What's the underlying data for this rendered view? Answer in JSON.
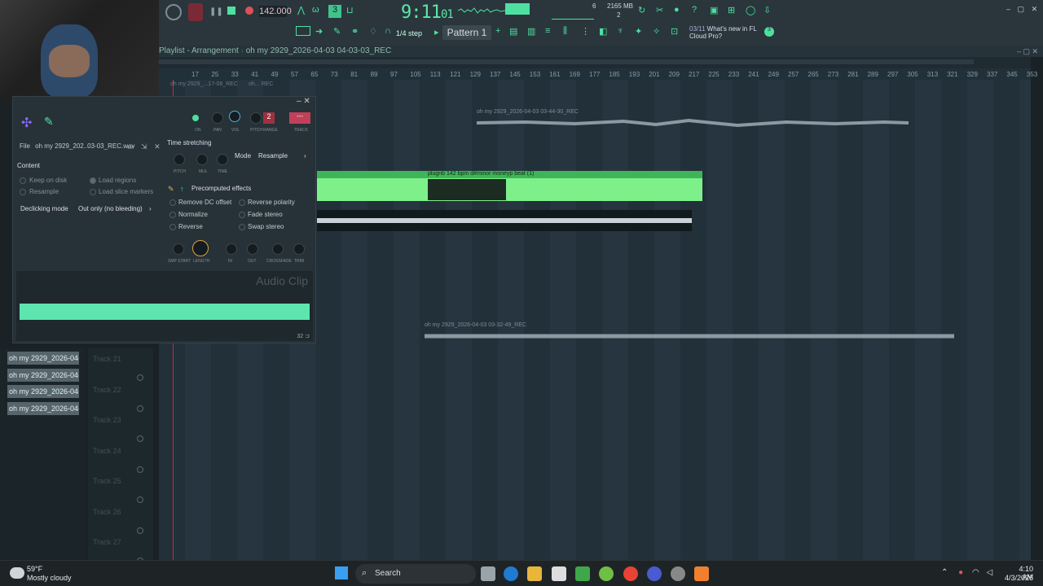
{
  "toolbar": {
    "tempo": "142.000",
    "time": "9:11",
    "time_sub": "01",
    "memory": "2165 MB",
    "cpu_top": "6",
    "cpu_bottom": "2",
    "step": "1/4 step",
    "pattern": "Pattern 1",
    "news_date": "03/11",
    "news_text": "What's new in FL",
    "news_text2": "Cloud Pro?",
    "news_count": "3"
  },
  "playlist": {
    "breadcrumb": "Playlist - Arrangement",
    "file": "oh my 2929_2026-04-03 04-03-03_REC",
    "ruler": [
      "17",
      "25",
      "33",
      "41",
      "49",
      "57",
      "65",
      "73",
      "81",
      "89",
      "97",
      "105",
      "113",
      "121",
      "129",
      "137",
      "145",
      "153",
      "161",
      "169",
      "177",
      "185",
      "193",
      "201",
      "209",
      "217",
      "225",
      "233",
      "241",
      "249",
      "257",
      "265",
      "273",
      "281",
      "289",
      "297",
      "305",
      "313",
      "321",
      "329",
      "337",
      "345",
      "353"
    ],
    "mini_clip1": "oh my 2929_...17-08_REC",
    "mini_clip2": "oh... REC",
    "clip_top": "oh my 2929_2026-04-03 03-44-30_REC",
    "clip_beat": "plugnb 142 bpm d#minor moneyp beat (1)",
    "clip_bottom": "oh my 2929_2026-04-03 03-32-49_REC",
    "tracks": [
      "Track 21",
      "Track 22",
      "Track 23",
      "Track 24",
      "Track 25",
      "Track 26",
      "Track 27"
    ]
  },
  "browser": {
    "items": [
      "oh my 2929_2026-04-03...",
      "oh my 2929_2026-04-03...",
      "oh my 2929_2026-04-03...",
      "oh my 2929_2026-04-03..."
    ]
  },
  "clip_window": {
    "file_label": "File",
    "file_name": "oh my 2929_202..03-03_REC.wav",
    "content": "Content",
    "keep_on_disk": "Keep on disk",
    "load_regions": "Load regions",
    "resample": "Resample",
    "load_slice": "Load slice markers",
    "declicking_label": "Declicking mode",
    "declicking_value": "Out only (no bleeding)",
    "knobs": [
      "ON",
      "PAN",
      "VOL",
      "PITCH",
      "RANGE",
      "TRACK"
    ],
    "pitch_range": "2",
    "track_value": "---",
    "time_stretching": "Time stretching",
    "ts_knobs": [
      "PITCH",
      "MUL",
      "TIME"
    ],
    "mode_label": "Mode",
    "mode_value": "Resample",
    "precomputed": "Precomputed effects",
    "effects": [
      "Remove DC offset",
      "Normalize",
      "Reverse",
      "Reverse polarity",
      "Fade stereo",
      "Swap stereo"
    ],
    "env_knobs": [
      "SMP START",
      "LENGTH",
      "IN",
      "OUT",
      "CROSSFADE",
      "TRIM"
    ],
    "title": "Audio Clip",
    "zoom": "32"
  },
  "taskbar": {
    "weather_temp": "59°F",
    "weather_desc": "Mostly cloudy",
    "search": "Search",
    "time": "4:10 AM",
    "date": "4/3/2026"
  },
  "colors": {
    "accent": "#4de0a0",
    "clip_green": "#7ef08a",
    "background": "#22303a"
  }
}
